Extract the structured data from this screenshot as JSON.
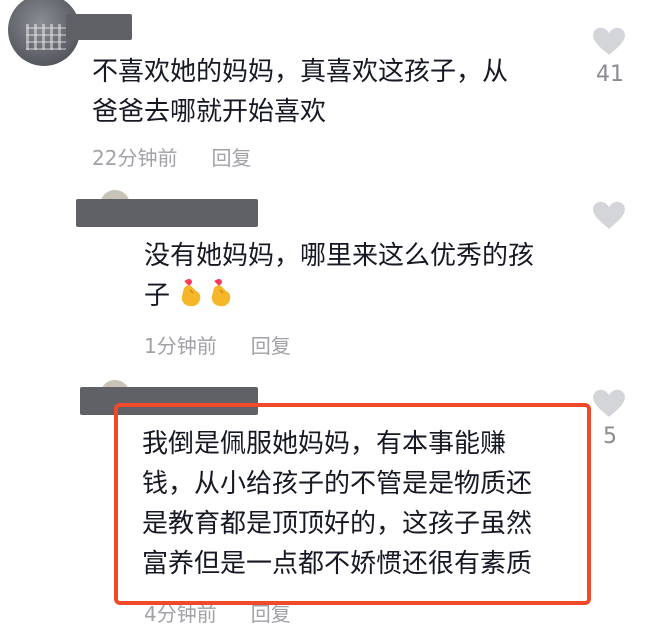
{
  "comments": [
    {
      "text_line1": "不喜欢她的妈妈，真喜欢这孩子，从",
      "text_line2": "爸爸去哪就开始喜欢",
      "time": "22分钟前",
      "reply_label": "回复",
      "likes": "41"
    },
    {
      "text_line1": "没有她妈妈，哪里来这么优秀的孩",
      "text_line2": "子",
      "emoji": [
        "finger-heart-emoji",
        "finger-heart-emoji"
      ],
      "time": "1分钟前",
      "reply_label": "回复",
      "likes": ""
    },
    {
      "text_line1": "我倒是佩服她妈妈，有本事能赚",
      "text_line2": "钱，从小给孩子的不管是是物质还",
      "text_line3": "是教育都是顶顶好的，这孩子虽然",
      "text_line4": "富养但是一点都不娇惯还很有素质",
      "time": "4分钟前",
      "reply_label": "回复",
      "likes": "5"
    }
  ],
  "colors": {
    "highlight": "#f04a2b",
    "redaction": "#5f6166",
    "meta_text": "#a1a2a7",
    "heart": "#d4d5d8"
  }
}
